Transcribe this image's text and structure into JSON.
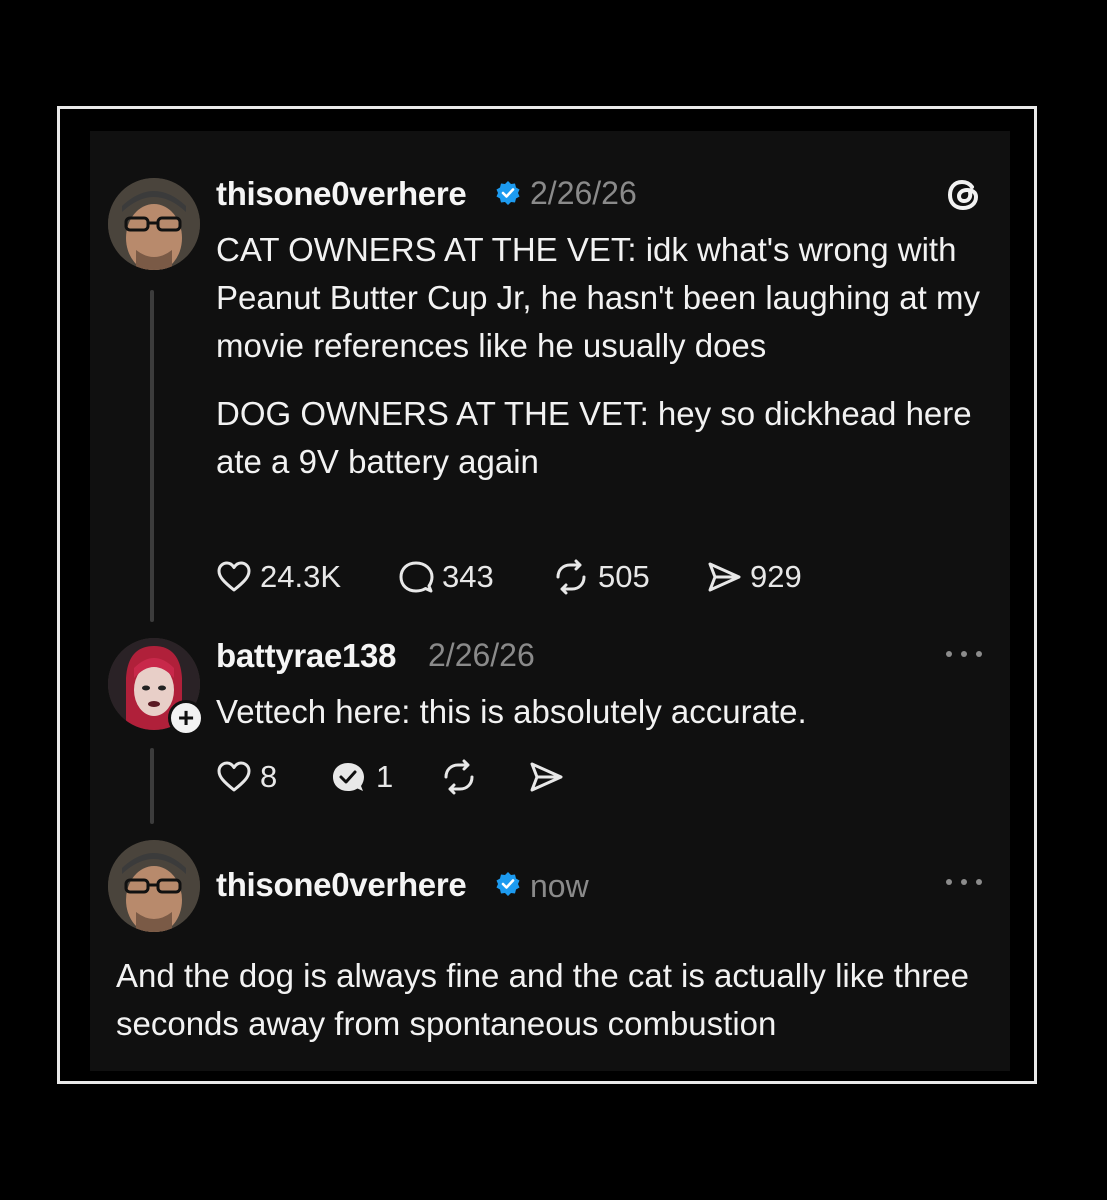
{
  "post": {
    "username": "thisone0verhere",
    "date": "2/26/26",
    "para1": "CAT OWNERS AT THE VET: idk what's wrong with Peanut Butter Cup Jr, he hasn't been laughing at my movie references like he usually does",
    "para2": "DOG OWNERS AT THE VET: hey so dickhead here ate a 9V battery again",
    "likes": "24.3K",
    "replies": "343",
    "reposts": "505",
    "shares": "929"
  },
  "reply": {
    "username": "battyrae138",
    "date": "2/26/26",
    "text": "Vettech here: this is absolutely accurate.",
    "likes": "8",
    "replies": "1"
  },
  "latest": {
    "username": "thisone0verhere",
    "time": "now",
    "text": "And the dog is always fine and the cat is actually like three seconds away from spontaneous combustion"
  },
  "colors": {
    "background": "#000000",
    "card": "#101010",
    "frame_border": "#e9e9e9",
    "verified_blue": "#1d9bf0",
    "muted_text": "#8a8a8a"
  },
  "icons": {
    "app_logo": "threads-logo-icon",
    "like": "heart-icon",
    "reply": "comment-bubble-icon",
    "repost": "repost-icon",
    "share": "send-icon",
    "more": "more-dots-icon",
    "follow": "plus-icon",
    "verified": "verified-badge-icon"
  }
}
